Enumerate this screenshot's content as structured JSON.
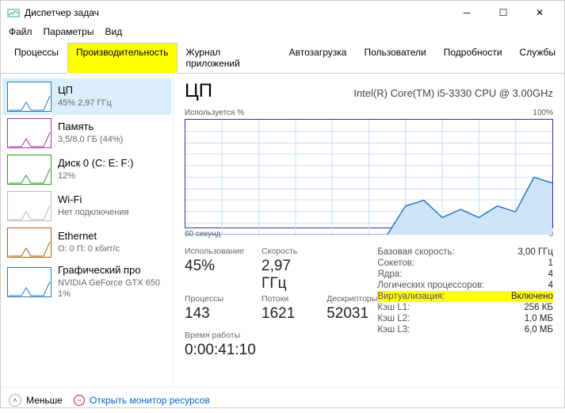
{
  "window": {
    "title": "Диспетчер задач"
  },
  "menu": {
    "file": "Файл",
    "options": "Параметры",
    "view": "Вид"
  },
  "tabs": {
    "items": [
      "Процессы",
      "Производительность",
      "Журнал приложений",
      "Автозагрузка",
      "Пользователи",
      "Подробности",
      "Службы"
    ],
    "active": 1
  },
  "sidebar": [
    {
      "title": "ЦП",
      "sub": "45% 2,97 ГГц",
      "color": "#2a7ab8",
      "selected": true
    },
    {
      "title": "Память",
      "sub": "3,5/8,0 ГБ (44%)",
      "color": "#b030a0"
    },
    {
      "title": "Диск 0 (C: E: F:)",
      "sub": "12%",
      "color": "#2a9a2a"
    },
    {
      "title": "Wi-Fi",
      "sub": "Нет подключения",
      "color": "#bbb"
    },
    {
      "title": "Ethernet",
      "sub": "О: 0 П: 0 кбит/с",
      "color": "#b06010"
    },
    {
      "title": "Графический про",
      "sub": "NVIDIA GeForce GTX 650",
      "sub2": "1%",
      "color": "#2a7ab8"
    }
  ],
  "cpu": {
    "heading": "ЦП",
    "model": "Intel(R) Core(TM) i5-3330 CPU @ 3.00GHz",
    "chart_top_left": "Используется %",
    "chart_top_right": "100%",
    "chart_bottom_left": "60 секунд",
    "chart_bottom_right": "0",
    "l_util": "Использование",
    "v_util": "45%",
    "l_speed": "Скорость",
    "v_speed": "2,97 ГГц",
    "l_proc": "Процессы",
    "v_proc": "143",
    "l_thr": "Потоки",
    "v_thr": "1621",
    "l_hnd": "Дескрипторы",
    "v_hnd": "52031",
    "l_up": "Время работы",
    "v_up": "0:00:41:10",
    "r": [
      {
        "k": "Базовая скорость:",
        "v": "3,00 ГГц"
      },
      {
        "k": "Сокетов:",
        "v": "1"
      },
      {
        "k": "Ядра:",
        "v": "4"
      },
      {
        "k": "Логических процессоров:",
        "v": "4"
      },
      {
        "k": "Виртуализация:",
        "v": "Включено",
        "hl": true
      },
      {
        "k": "Кэш L1:",
        "v": "256 КБ"
      },
      {
        "k": "Кэш L2:",
        "v": "1,0 МБ"
      },
      {
        "k": "Кэш L3:",
        "v": "6,0 МБ"
      }
    ]
  },
  "footer": {
    "less": "Меньше",
    "resmon": "Открыть монитор ресурсов"
  },
  "chart_data": {
    "type": "line",
    "title": "Используется %",
    "xlabel": "60 секунд",
    "ylabel": "%",
    "ylim": [
      0,
      100
    ],
    "x_seconds_ago": [
      60,
      57,
      54,
      51,
      48,
      45,
      42,
      39,
      36,
      33,
      30,
      27,
      24,
      21,
      18,
      15,
      12,
      9,
      6,
      3,
      0
    ],
    "values_percent": [
      0,
      0,
      0,
      0,
      0,
      0,
      0,
      0,
      0,
      0,
      0,
      0,
      25,
      30,
      15,
      22,
      15,
      25,
      20,
      50,
      45
    ]
  }
}
